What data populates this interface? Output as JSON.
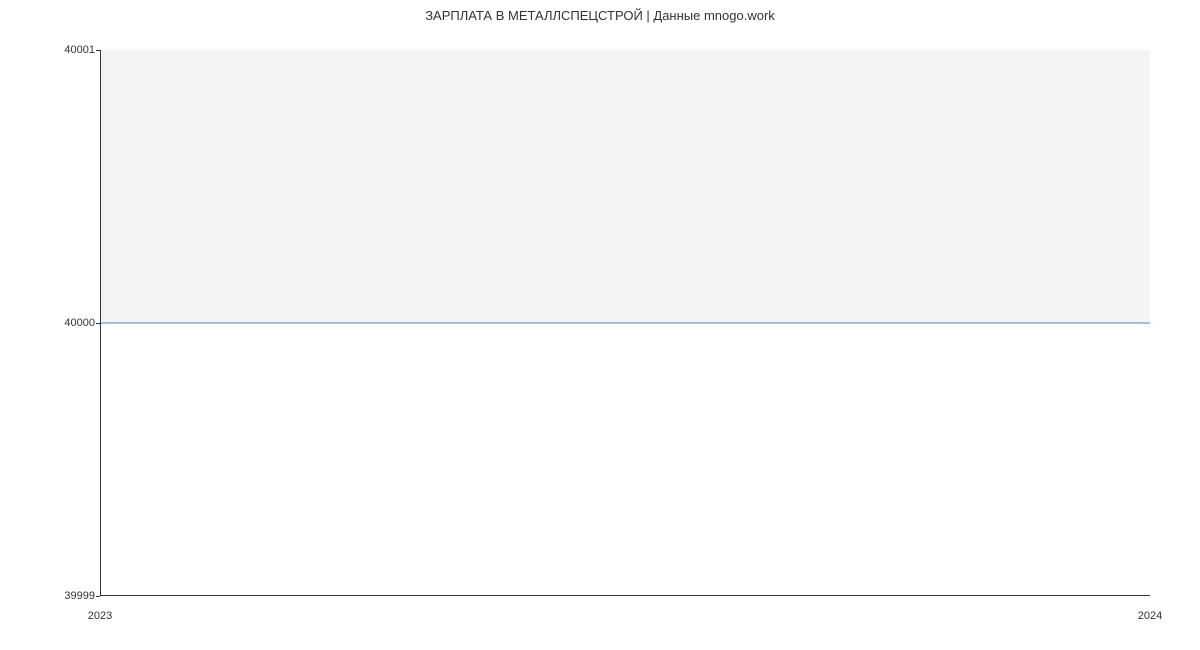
{
  "chart_data": {
    "type": "line",
    "title": "ЗАРПЛАТА В  МЕТАЛЛСПЕЦСТРОЙ | Данные mnogo.work",
    "x": [
      2023,
      2024
    ],
    "values": [
      40000,
      40000
    ],
    "xlabel": "",
    "ylabel": "",
    "xlim": [
      2023,
      2024
    ],
    "ylim": [
      39999,
      40001
    ],
    "x_ticks": [
      "2023",
      "2024"
    ],
    "y_ticks": [
      "39999",
      "40000",
      "40001"
    ],
    "line_color": "#4a88c7",
    "shaded_under": true
  }
}
